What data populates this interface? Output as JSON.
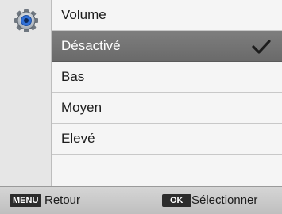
{
  "menu": {
    "icon": "settings-gear-icon",
    "items": [
      {
        "label": "Volume",
        "selected": false
      },
      {
        "label": "Désactivé",
        "selected": true
      },
      {
        "label": "Bas",
        "selected": false
      },
      {
        "label": "Moyen",
        "selected": false
      },
      {
        "label": "Elevé",
        "selected": false
      }
    ]
  },
  "footer": {
    "back_key": "MENU",
    "back_label": "Retour",
    "ok_key": "OK",
    "ok_label": "Sélectionner"
  },
  "colors": {
    "selected_row": "#737373",
    "check_mark": "#1c1c1c",
    "gear_accent": "#2f6fd6"
  }
}
